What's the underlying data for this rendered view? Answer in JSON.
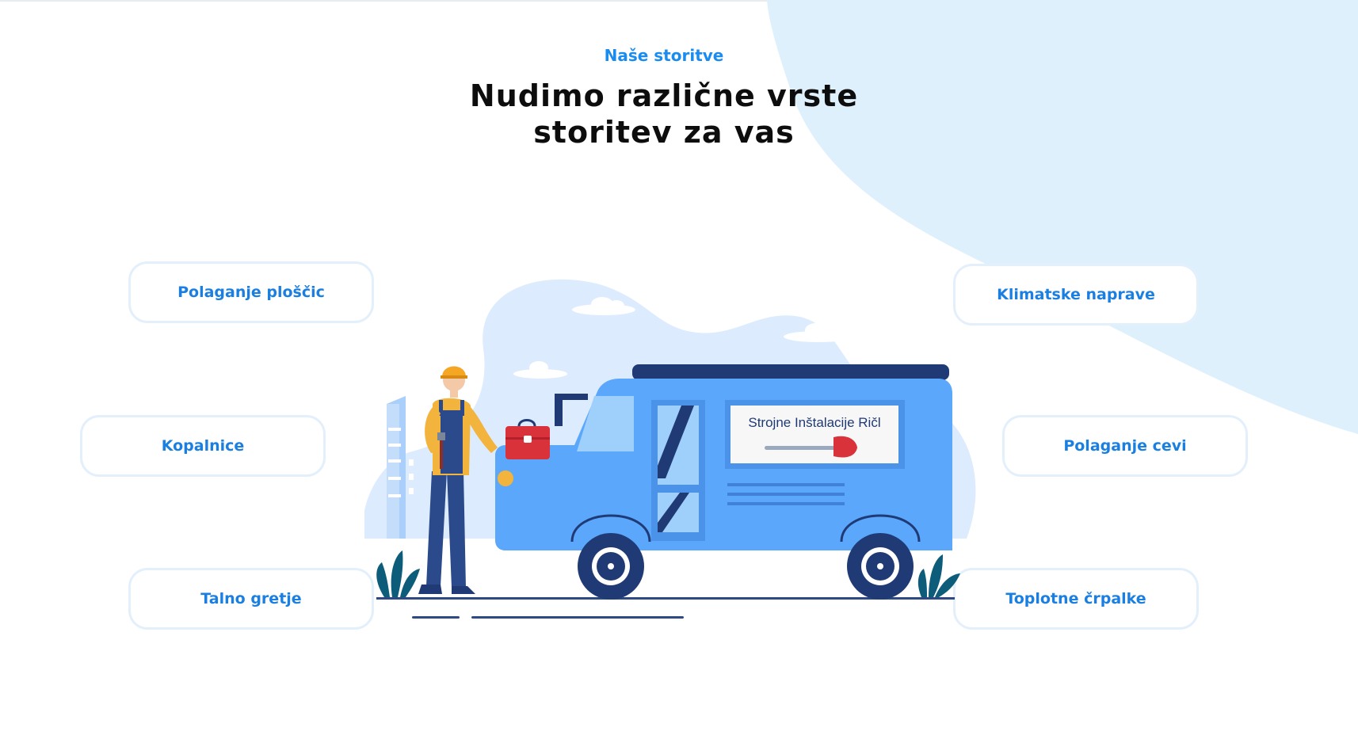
{
  "section": {
    "eyebrow": "Naše storitve",
    "heading": "Nudimo različne vrste storitev za vas"
  },
  "services": {
    "left": [
      "Polaganje ploščic",
      "Kopalnice",
      "Talno gretje"
    ],
    "right": [
      "Klimatske naprave",
      "Polaganje cevi",
      "Toplotne črpalke"
    ]
  },
  "illustration": {
    "van_sign": "Strojne Inštalacije Ričl"
  },
  "colors": {
    "accent": "#1a8cf0",
    "heading": "#0d0d0d",
    "card_border": "#e3f0fc",
    "background_blob": "#dff0fd",
    "van": "#5aa7fb",
    "van_dark": "#1f3a75"
  }
}
